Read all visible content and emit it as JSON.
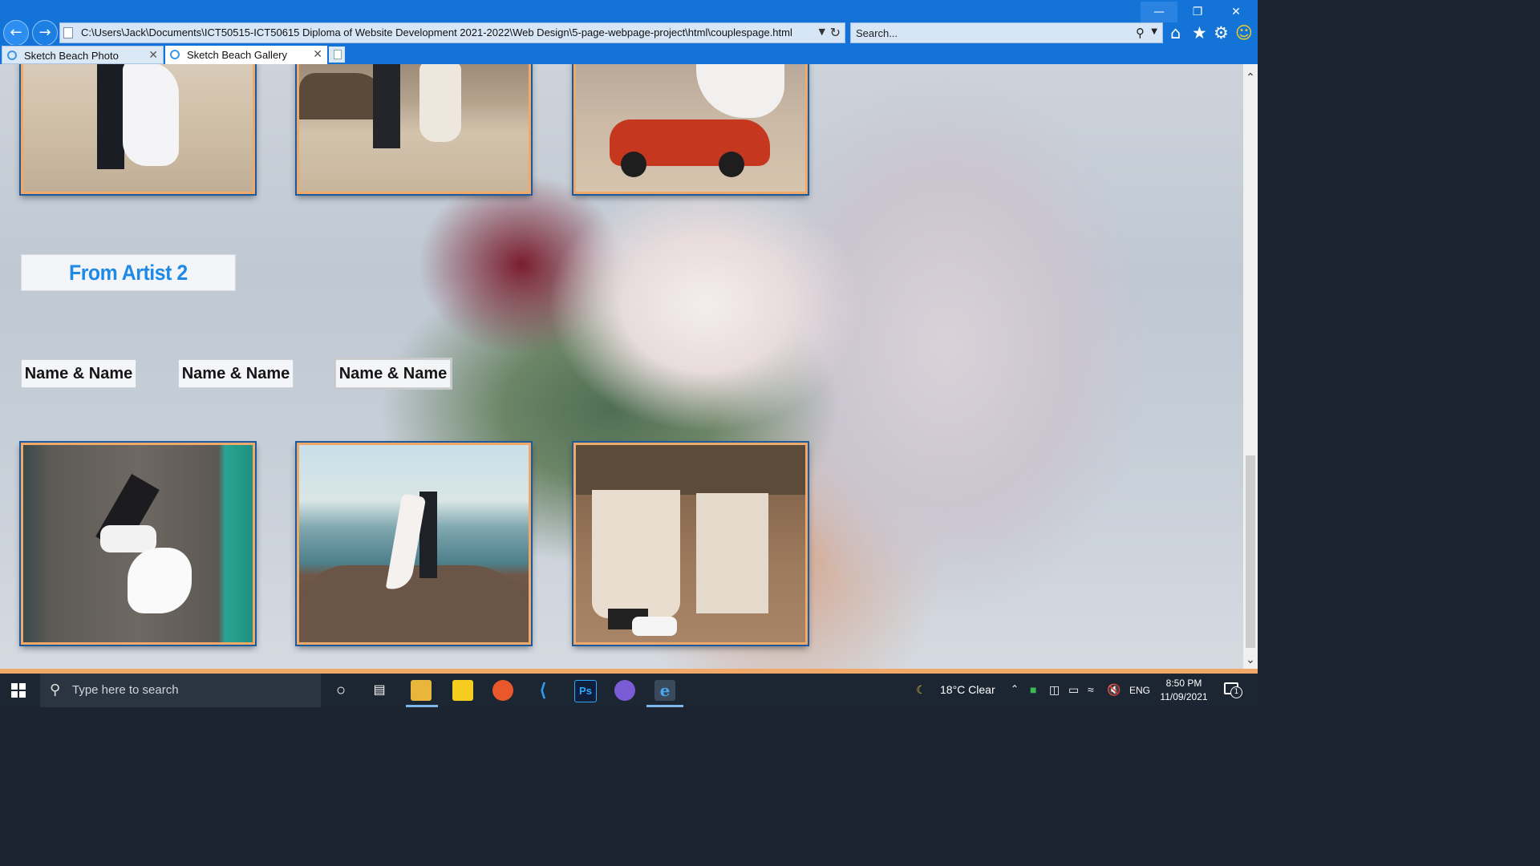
{
  "browser": {
    "address_url": "C:\\Users\\Jack\\Documents\\ICT50515-ICT50615 Diploma of Website Development 2021-2022\\Web Design\\5-page-webpage-project\\html\\couplespage.html",
    "search_placeholder": "Search...",
    "tabs": [
      {
        "label": "Sketch Beach Photo",
        "active": false
      },
      {
        "label": "Sketch Beach Gallery",
        "active": true
      }
    ]
  },
  "gallery": {
    "artist_heading": "From Artist 2",
    "name_buttons": [
      "Name & Name",
      "Name & Name",
      "Name & Name"
    ]
  },
  "taskbar": {
    "search_placeholder": "Type here to search",
    "weather": "18°C  Clear",
    "language": "ENG",
    "time": "8:50 PM",
    "date": "11/09/2021",
    "notification_count": "1"
  },
  "colors": {
    "accent_blue": "#1473d6",
    "frame_orange": "#f0a968",
    "heading_blue": "#1e8ae6"
  }
}
